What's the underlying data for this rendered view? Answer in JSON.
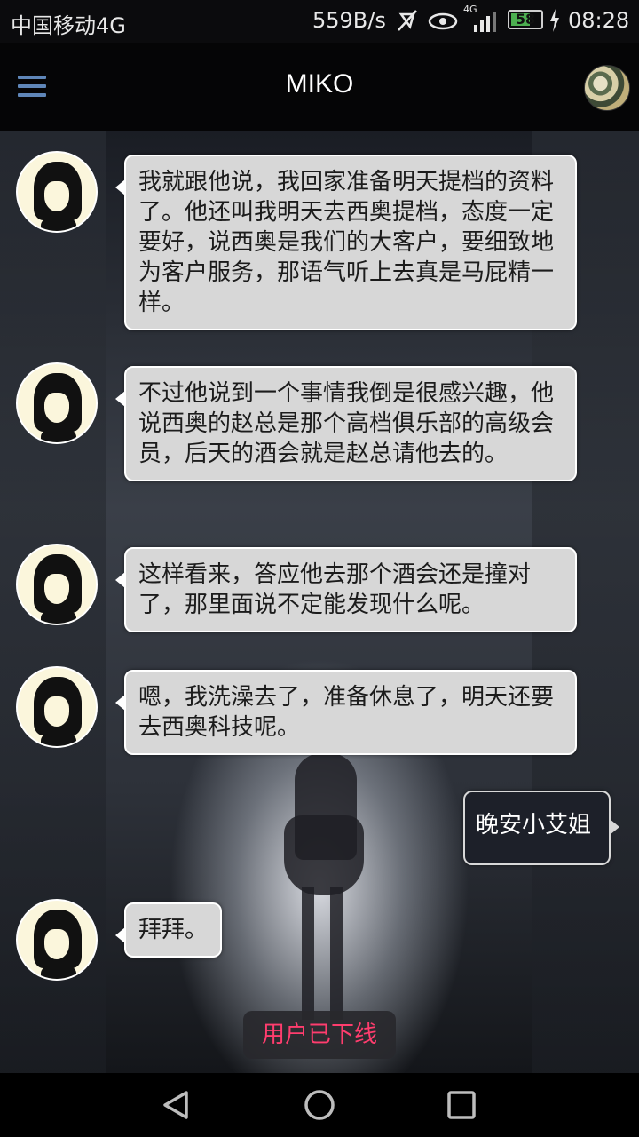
{
  "status_bar": {
    "carrier": "中国移动4G",
    "speed": "559B/s",
    "network": "4G",
    "battery": "58",
    "time": "08:28",
    "icons": [
      "mute-icon",
      "eye-icon",
      "signal-icon",
      "charging-icon"
    ]
  },
  "app_bar": {
    "title": "MIKO",
    "menu_icon": "hamburger-icon"
  },
  "messages": [
    {
      "side": "left",
      "text": "我就跟他说，我回家准备明天提档的资料了。他还叫我明天去西奥提档，态度一定要好，说西奥是我们的大客户，要细致地为客户服务，那语气听上去真是马屁精一样。"
    },
    {
      "side": "left",
      "text": "不过他说到一个事情我倒是很感兴趣，他说西奥的赵总是那个高档俱乐部的高级会员，后天的酒会就是赵总请他去的。"
    },
    {
      "side": "left",
      "text": "这样看来，答应他去那个酒会还是撞对了，那里面说不定能发现什么呢。"
    },
    {
      "side": "left",
      "text": "嗯，我洗澡去了，准备休息了，明天还要去西奥科技呢。"
    },
    {
      "side": "right",
      "text": "晚安小艾姐"
    },
    {
      "side": "left",
      "text": "拜拜。"
    }
  ],
  "toast": {
    "text": "用户已下线",
    "color": "#ff3d6e"
  },
  "nav_bar": {
    "icons": [
      "back-icon",
      "home-icon",
      "recents-icon"
    ]
  },
  "colors": {
    "bubble_left": "#d7d7d7",
    "bubble_right": "#1d2029",
    "menu_icon": "#5f86b8"
  }
}
